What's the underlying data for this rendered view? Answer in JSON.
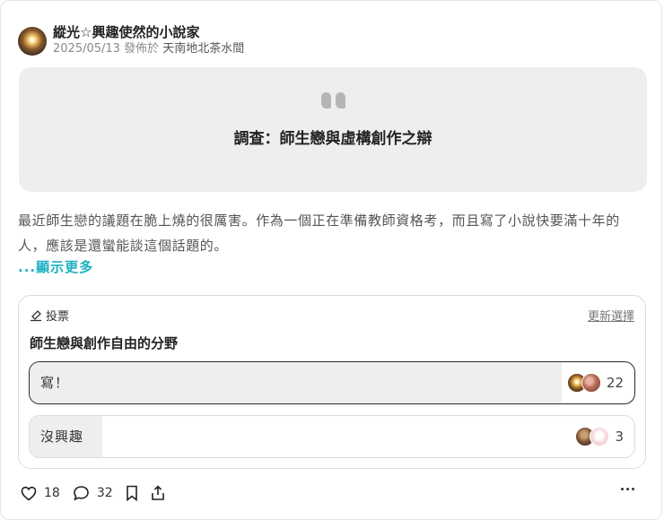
{
  "author": {
    "name": "縱光☆興趣使然的小說家",
    "date": "2025/05/13",
    "posted_in": "發佈於",
    "board": "天南地北茶水間"
  },
  "cover": {
    "title": "調查：師生戀與虛構創作之辯"
  },
  "excerpt": "最近師生戀的議題在脆上燒的很厲害。作為一個正在準備教師資格考，而且寫了小說快要滿十年的人，應該是還蠻能談這個話題的。",
  "show_more": "...顯示更多",
  "poll": {
    "header": "投票",
    "update_label": "更新選擇",
    "question": "師生戀與創作自由的分野",
    "options": [
      {
        "label": "寫！",
        "count": "22",
        "fraction": 0.88,
        "selected": true
      },
      {
        "label": "沒興趣",
        "count": "3",
        "fraction": 0.12,
        "selected": false
      }
    ]
  },
  "actions": {
    "likes": "18",
    "comments": "32"
  },
  "colors": {
    "accent": "#1bb0c0",
    "cover_bg": "#efeeec"
  }
}
